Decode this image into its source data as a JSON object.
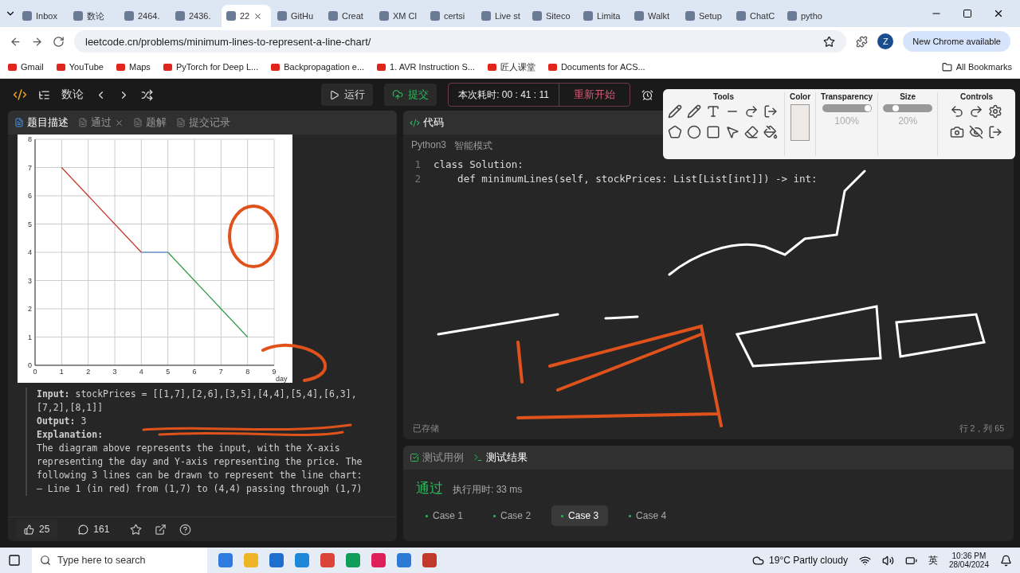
{
  "browser": {
    "tabs": [
      {
        "label": "Inbox",
        "selected": false
      },
      {
        "label": "数论",
        "selected": false
      },
      {
        "label": "2464.",
        "selected": false
      },
      {
        "label": "2436.",
        "selected": false
      },
      {
        "label": "22",
        "selected": true
      },
      {
        "label": "GitHu",
        "selected": false
      },
      {
        "label": "Creat",
        "selected": false
      },
      {
        "label": "XM Cl",
        "selected": false
      },
      {
        "label": "certsi",
        "selected": false
      },
      {
        "label": "Live st",
        "selected": false
      },
      {
        "label": "Siteco",
        "selected": false
      },
      {
        "label": "Limita",
        "selected": false
      },
      {
        "label": "Walkt",
        "selected": false
      },
      {
        "label": "Setup",
        "selected": false
      },
      {
        "label": "ChatC",
        "selected": false
      },
      {
        "label": "pytho",
        "selected": false
      }
    ],
    "address": "leetcode.cn/problems/minimum-lines-to-represent-a-line-chart/",
    "profile": "Z",
    "update_button": "New Chrome available",
    "bookmarks": [
      "Gmail",
      "YouTube",
      "Maps",
      "PyTorch for Deep L...",
      "Backpropagation e...",
      "1. AVR Instruction S...",
      "匠人课堂",
      "Documents for ACS..."
    ],
    "all_bookmarks": "All Bookmarks"
  },
  "app": {
    "title": "数论",
    "run": "运行",
    "submit": "提交",
    "timer": "本次耗时: 00 : 41 : 11",
    "restart": "重新开始"
  },
  "left_panel": {
    "tabs": [
      {
        "label": "题目描述",
        "selected": true
      },
      {
        "label": "通过",
        "selected": false
      },
      {
        "label": "题解",
        "selected": false
      },
      {
        "label": "提交记录",
        "selected": false
      }
    ],
    "chart_data": {
      "type": "line",
      "grid": true,
      "xlabel": "day",
      "x": [
        1,
        2,
        3,
        4,
        5,
        6,
        7,
        8
      ],
      "xlim": [
        0,
        9
      ],
      "ylim": [
        0,
        8
      ],
      "xticks": [
        0,
        1,
        2,
        3,
        4,
        5,
        6,
        7,
        8,
        9
      ],
      "yticks": [
        0,
        1,
        2,
        3,
        4,
        5,
        6,
        7,
        8
      ],
      "series": [
        {
          "color": "#c0392b",
          "values": [
            7,
            6,
            5,
            4,
            null,
            null,
            null,
            null
          ]
        },
        {
          "color": "#2f6fc0",
          "values": [
            null,
            null,
            null,
            4,
            4,
            null,
            null,
            null
          ]
        },
        {
          "color": "#2e9b4a",
          "values": [
            null,
            null,
            null,
            null,
            4,
            3,
            2,
            1
          ]
        }
      ]
    },
    "example": [
      "**Input:** stockPrices = [[1,7],[2,6],[3,5],[4,4],[5,4],[6,3],[7,2],[8,1]]",
      "**Output:** 3"
    ],
    "explanation_title": "Explanation:",
    "explanation": "The diagram above represents the input, with the X-axis representing the day and Y-axis representing the price. The following 3 lines can be drawn to represent the line chart:",
    "last_line": "– Line 1 (in red) from (1,7) to (4,4) passing through (1,7)",
    "likes": "25",
    "comments": "161"
  },
  "code_panel": {
    "title": "代码",
    "language": "Python3",
    "mode": "智能模式",
    "lines": [
      {
        "number": "1",
        "code": "class Solution:"
      },
      {
        "number": "2",
        "code": "    def minimumLines(self, stockPrices: List[List[int]]) -> int:"
      }
    ],
    "saved": "已存储",
    "position": "行 2，列 65"
  },
  "tools": {
    "tools_title": "Tools",
    "color_title": "Color",
    "color": "#ece9e6",
    "transparency_title": "Transparency",
    "transparency": {
      "level": 1,
      "reading": "100%"
    },
    "size_title": "Size",
    "size": {
      "level": 0.2,
      "reading": "20%"
    },
    "controls_title": "Controls"
  },
  "results": {
    "tabs": [
      {
        "label": "测试用例",
        "selected": false
      },
      {
        "label": "测试结果",
        "selected": true
      }
    ],
    "status": "通过",
    "runtime": "执行用时: 33 ms",
    "cases": [
      {
        "label": "Case 1",
        "selected": false
      },
      {
        "label": "Case 2",
        "selected": false
      },
      {
        "label": "Case 3",
        "selected": true
      },
      {
        "label": "Case 4",
        "selected": false
      }
    ]
  },
  "taskbar": {
    "search": "Type here to search",
    "weather": "19°C  Partly cloudy",
    "language": "英",
    "time": "10:36 PM",
    "date": "28/04/2024"
  }
}
